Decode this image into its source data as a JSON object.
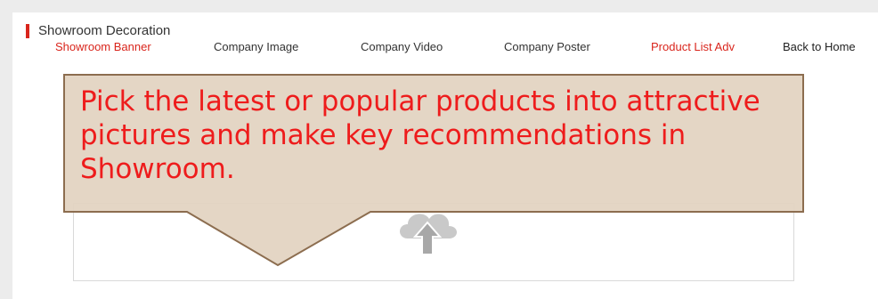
{
  "section": {
    "title": "Showroom Decoration"
  },
  "tabs": [
    {
      "label": "Showroom Banner",
      "active": true
    },
    {
      "label": "Company Image",
      "active": false
    },
    {
      "label": "Company Video",
      "active": false
    },
    {
      "label": "Company Poster",
      "active": false
    },
    {
      "label": "Product List Adv",
      "active": false
    }
  ],
  "back_link": {
    "label": "Back to Home"
  },
  "callout": {
    "text": "Pick the latest or popular products into attractive pictures and make key recommendations in Showroom."
  },
  "upload": {
    "icon": "cloud-upload-icon"
  },
  "colors": {
    "accent": "#d9251c",
    "callout_fill": "#e2d3c1",
    "callout_border": "#8c6d4f",
    "callout_text": "#ee1c1c"
  }
}
